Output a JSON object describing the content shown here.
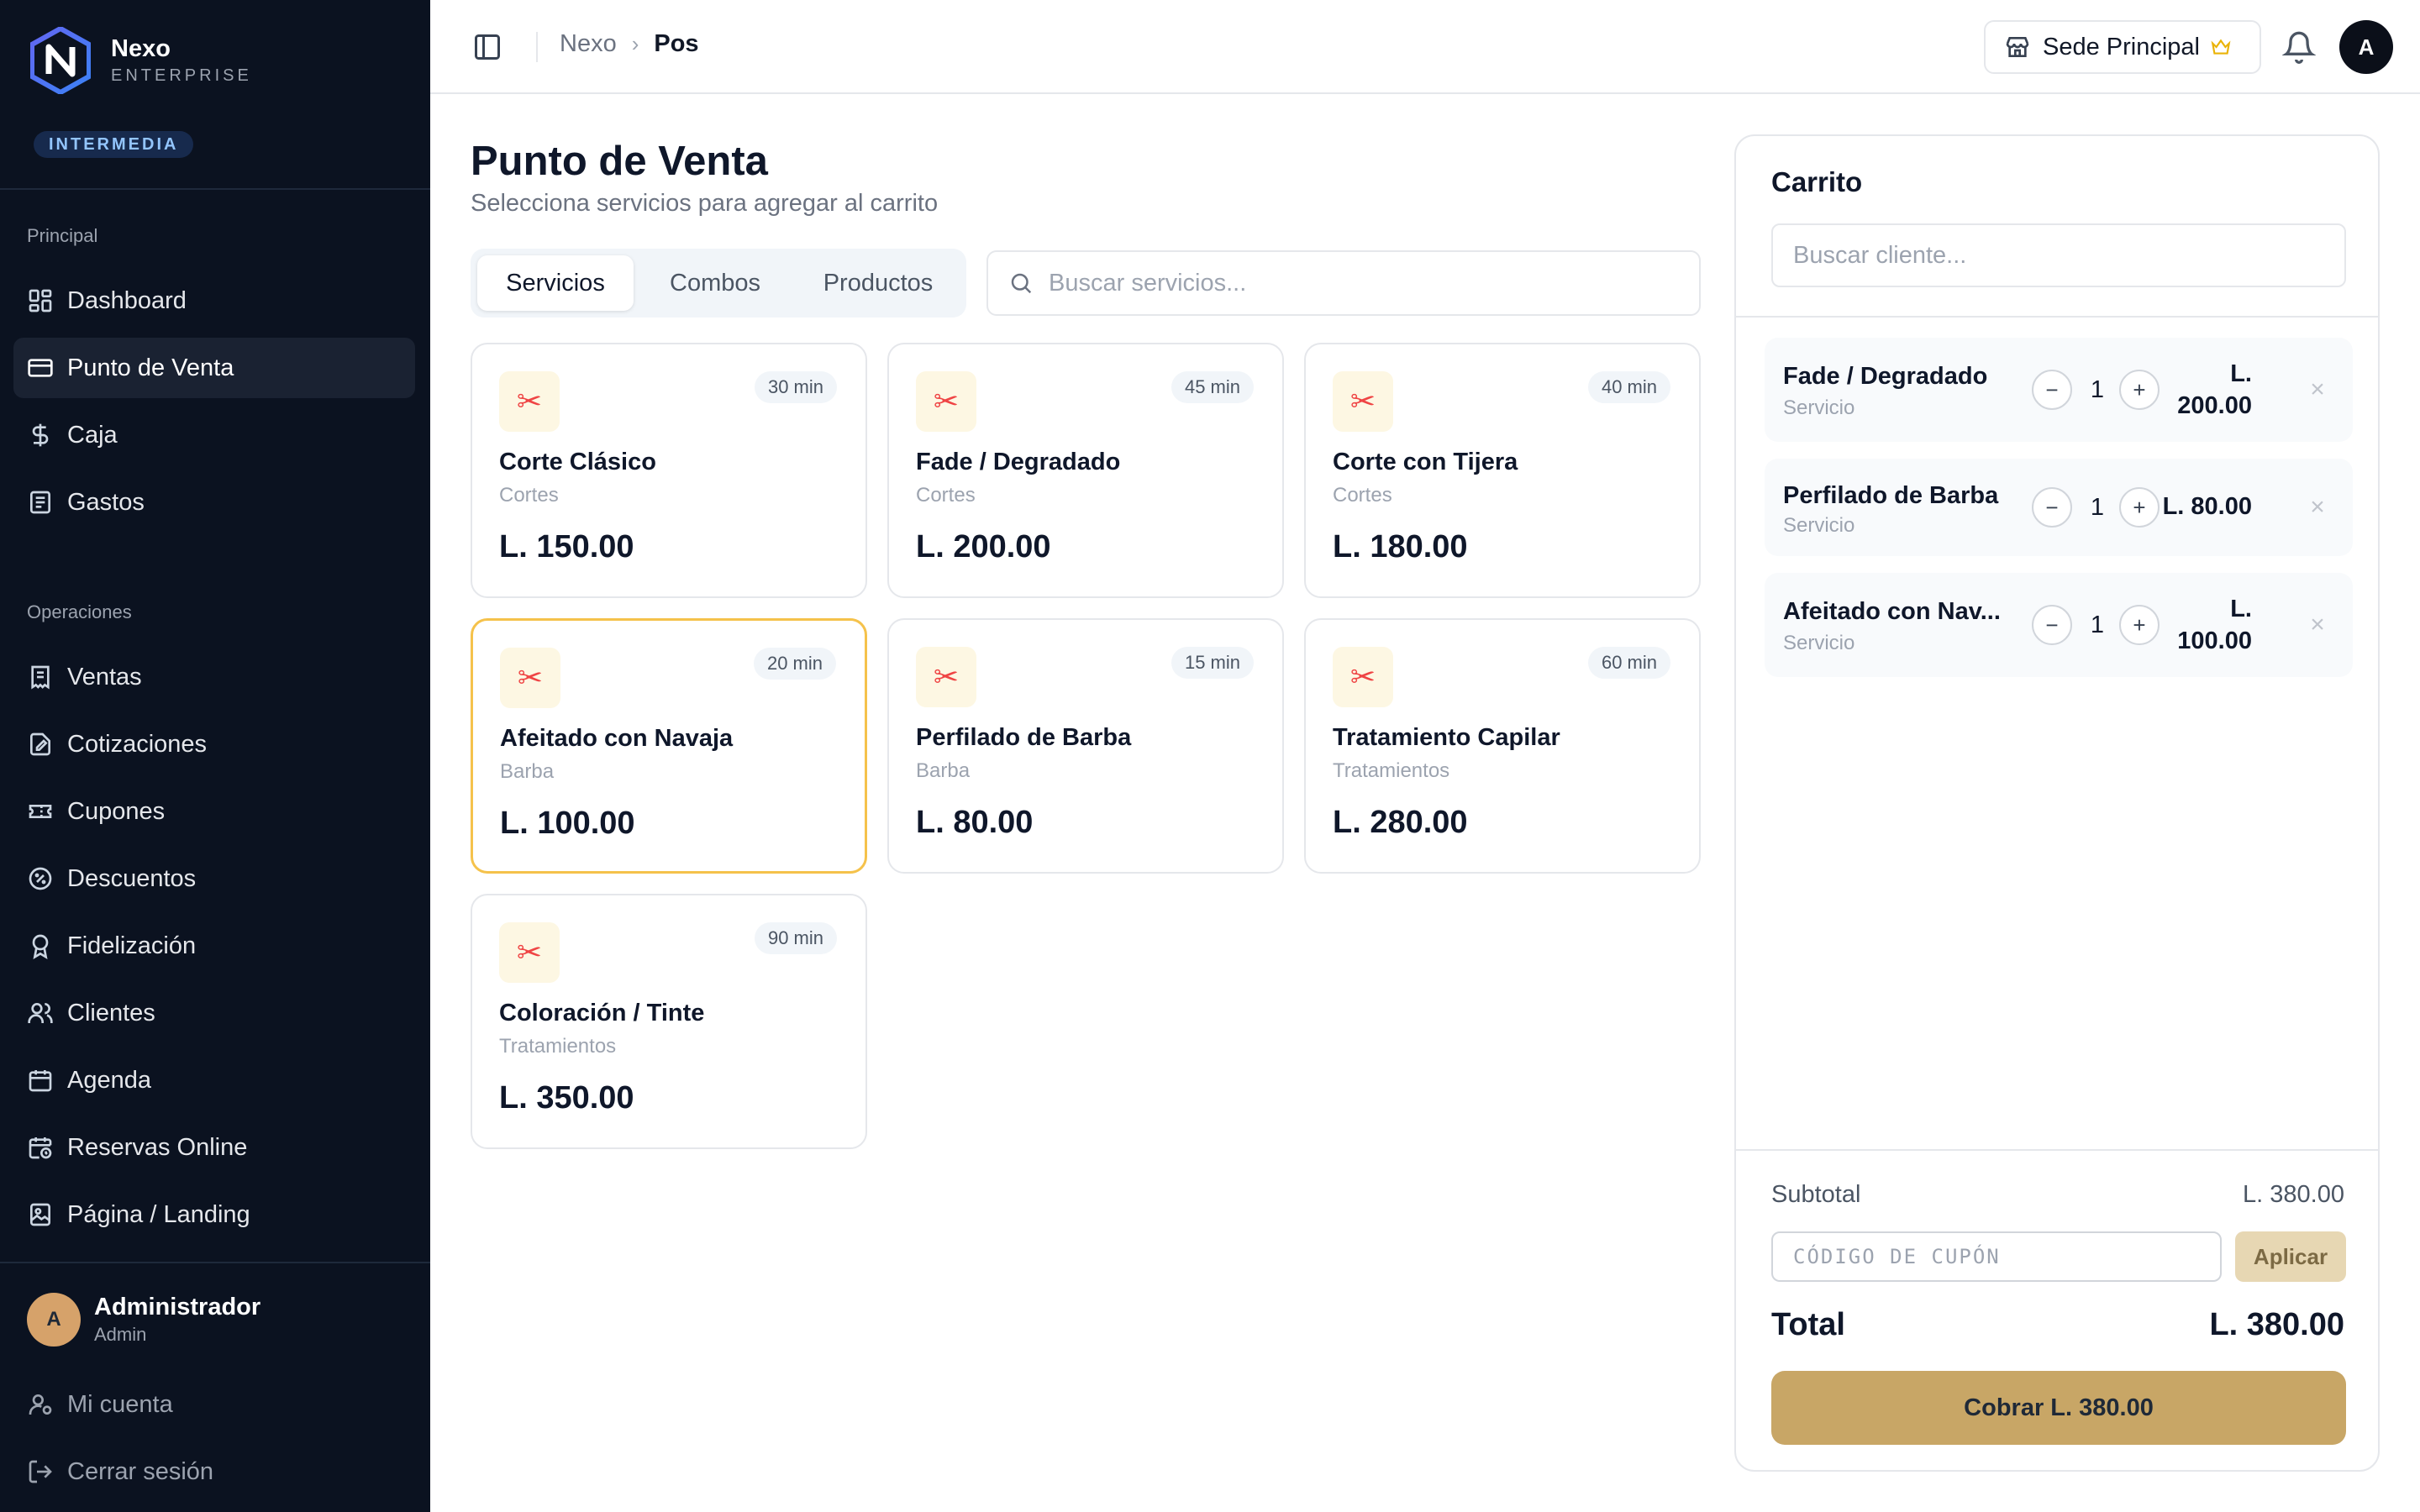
{
  "brand": {
    "name": "Nexo",
    "subtitle": "ENTERPRISE",
    "plan_badge": "INTERMEDIA"
  },
  "sidebar": {
    "section_principal": "Principal",
    "principal_items": [
      {
        "label": "Dashboard",
        "icon": "dashboard-icon"
      },
      {
        "label": "Punto de Venta",
        "icon": "card-icon",
        "active": true
      },
      {
        "label": "Caja",
        "icon": "dollar-icon"
      },
      {
        "label": "Gastos",
        "icon": "receipt-icon"
      }
    ],
    "section_operaciones": "Operaciones",
    "operaciones_items": [
      {
        "label": "Ventas",
        "icon": "receipt-icon"
      },
      {
        "label": "Cotizaciones",
        "icon": "document-edit-icon"
      },
      {
        "label": "Cupones",
        "icon": "ticket-icon"
      },
      {
        "label": "Descuentos",
        "icon": "percent-badge-icon"
      },
      {
        "label": "Fidelización",
        "icon": "award-icon"
      },
      {
        "label": "Clientes",
        "icon": "users-icon"
      },
      {
        "label": "Agenda",
        "icon": "calendar-icon"
      },
      {
        "label": "Reservas Online",
        "icon": "calendar-clock-icon"
      },
      {
        "label": "Página / Landing",
        "icon": "image-page-icon"
      }
    ],
    "user": {
      "initial": "A",
      "name": "Administrador",
      "role": "Admin"
    },
    "account_label": "Mi cuenta",
    "logout_label": "Cerrar sesión"
  },
  "header": {
    "breadcrumb_root": "Nexo",
    "breadcrumb_current": "Pos",
    "branch_label": "Sede Principal",
    "avatar_initial": "A"
  },
  "main": {
    "title": "Punto de Venta",
    "subtitle": "Selecciona servicios para agregar al carrito",
    "tabs": [
      {
        "label": "Servicios",
        "active": true
      },
      {
        "label": "Combos"
      },
      {
        "label": "Productos"
      }
    ],
    "search_placeholder": "Buscar servicios...",
    "services": [
      {
        "name": "Corte Clásico",
        "category": "Cortes",
        "price": "L. 150.00",
        "duration": "30 min"
      },
      {
        "name": "Fade / Degradado",
        "category": "Cortes",
        "price": "L. 200.00",
        "duration": "45 min"
      },
      {
        "name": "Corte con Tijera",
        "category": "Cortes",
        "price": "L. 180.00",
        "duration": "40 min"
      },
      {
        "name": "Afeitado con Navaja",
        "category": "Barba",
        "price": "L. 100.00",
        "duration": "20 min",
        "selected": true
      },
      {
        "name": "Perfilado de Barba",
        "category": "Barba",
        "price": "L. 80.00",
        "duration": "15 min"
      },
      {
        "name": "Tratamiento Capilar",
        "category": "Tratamientos",
        "price": "L. 280.00",
        "duration": "60 min"
      },
      {
        "name": "Coloración / Tinte",
        "category": "Tratamientos",
        "price": "L. 350.00",
        "duration": "90 min"
      }
    ]
  },
  "cart": {
    "title": "Carrito",
    "customer_placeholder": "Buscar cliente...",
    "items": [
      {
        "name": "Fade / Degradado",
        "type": "Servicio",
        "qty": "1",
        "price_line1": "L.",
        "price_line2": "200.00"
      },
      {
        "name": "Perfilado de Barba",
        "type": "Servicio",
        "qty": "1",
        "price": "L. 80.00"
      },
      {
        "name": "Afeitado con Nav...",
        "type": "Servicio",
        "qty": "1",
        "price_line1": "L.",
        "price_line2": "100.00"
      }
    ],
    "minus": "−",
    "plus": "+",
    "remove": "×",
    "subtotal_label": "Subtotal",
    "subtotal_value": "L. 380.00",
    "coupon_placeholder": "CÓDIGO DE CUPÓN",
    "apply_label": "Aplicar",
    "total_label": "Total",
    "total_value": "L. 380.00",
    "pay_label": "Cobrar L. 380.00"
  },
  "colors": {
    "sidebar_bg": "#0b1220",
    "accent_gold": "#c8a666",
    "selected_border": "#f5c24b"
  }
}
